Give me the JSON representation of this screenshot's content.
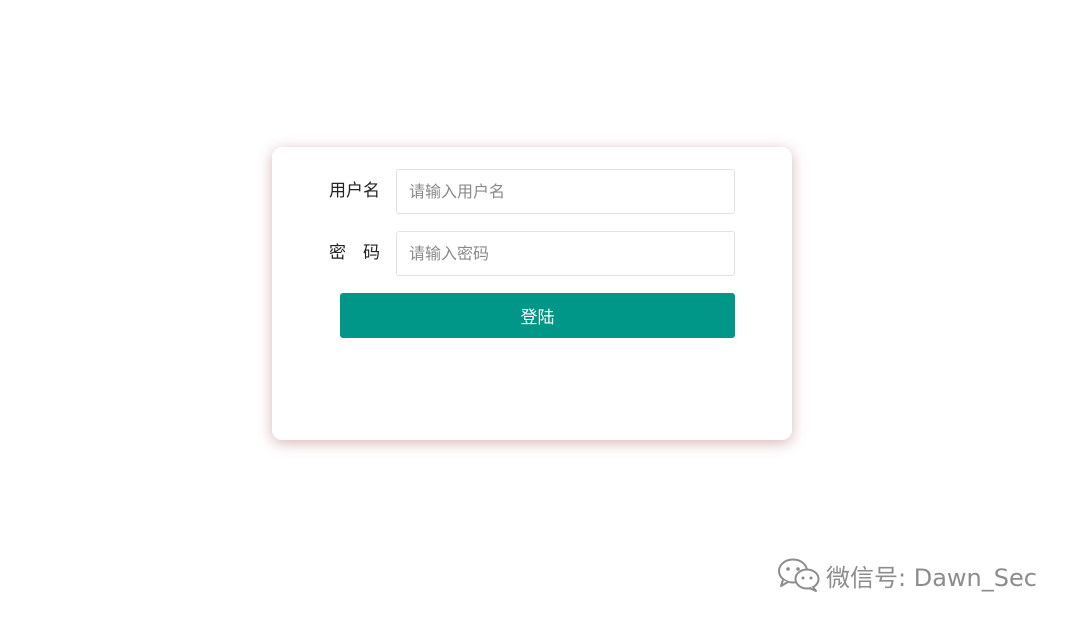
{
  "login_form": {
    "username": {
      "label": "用户名",
      "placeholder": "请输入用户名",
      "value": ""
    },
    "password": {
      "label": "密　码",
      "placeholder": "请输入密码",
      "value": ""
    },
    "submit_label": "登陆"
  },
  "watermark": {
    "icon": "wechat-icon",
    "text": "微信号: Dawn_Sec"
  },
  "colors": {
    "primary_button": "#009688",
    "card_shadow": "#c89a9a",
    "watermark_text": "#8c8c8c"
  }
}
